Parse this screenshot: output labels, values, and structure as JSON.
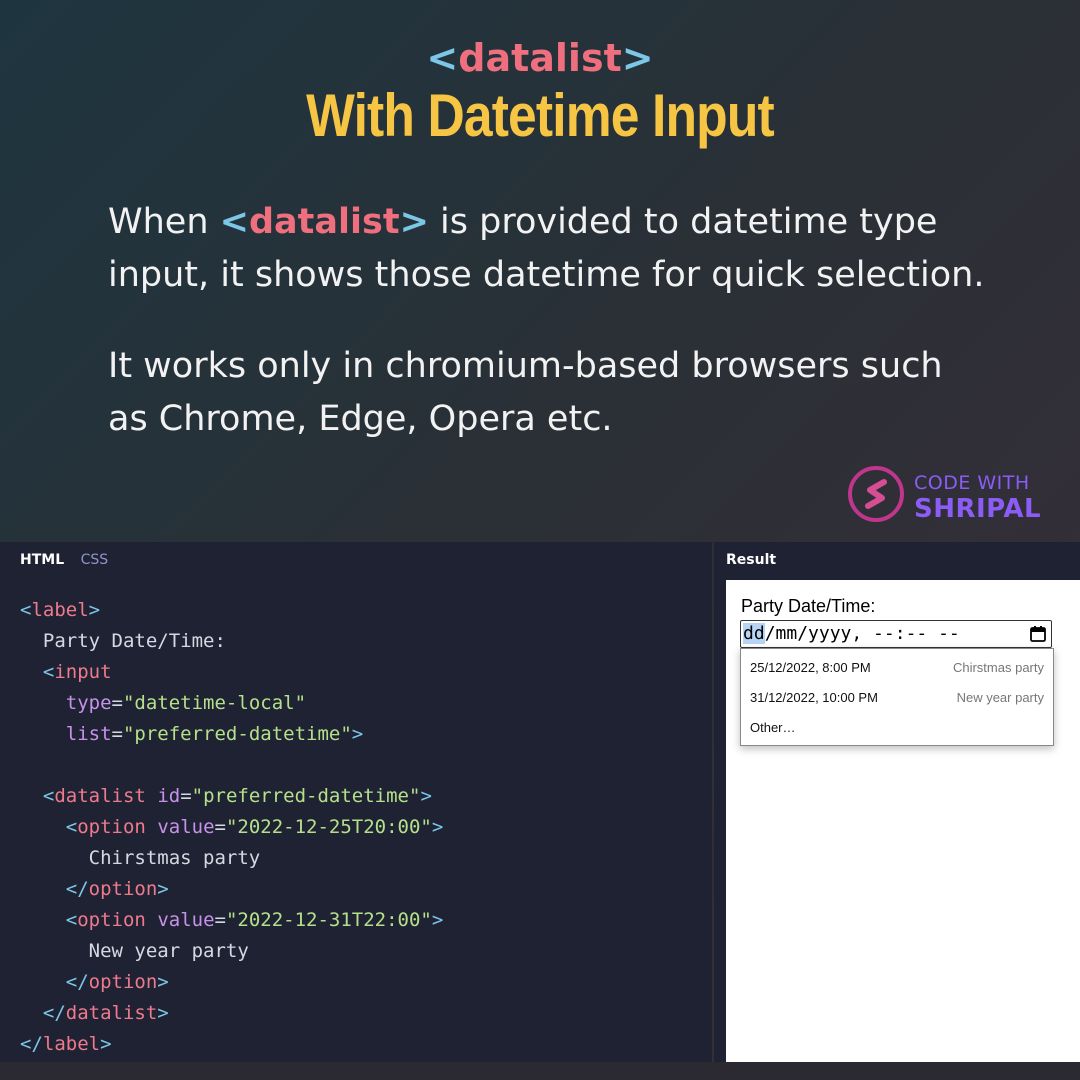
{
  "header": {
    "tag_open": "<",
    "tag_name": "datalist",
    "tag_close": ">",
    "title": "With Datetime Input"
  },
  "description": {
    "p1_before": "When ",
    "p1_tag_open": "<",
    "p1_tag_name": "datalist",
    "p1_tag_close": ">",
    "p1_after": " is provided to datetime type input, it shows those datetime for quick selection.",
    "p2": "It works only in chromium-based browsers such as Chrome, Edge, Opera etc."
  },
  "logo": {
    "line1": "CODE WITH",
    "line2": "SHRIPAL",
    "color": "#8b5cf6"
  },
  "editor": {
    "tabs": [
      {
        "label": "HTML"
      },
      {
        "label": "CSS"
      }
    ],
    "code": {
      "label_open": "label",
      "label_text": "Party Date/Time:",
      "input_tag": "input",
      "type_attr": "type",
      "type_value": "\"datetime-local\"",
      "list_attr": "list",
      "list_value": "\"preferred-datetime\"",
      "datalist_tag": "datalist",
      "id_attr": "id",
      "id_value": "\"preferred-datetime\"",
      "option_tag": "option",
      "value_attr": "value",
      "option1_value": "\"2022-12-25T20:00\"",
      "option1_text": "Chirstmas party",
      "option2_value": "\"2022-12-31T22:00\"",
      "option2_text": "New year party"
    }
  },
  "result": {
    "title": "Result",
    "field_label": "Party Date/Time:",
    "input_highlight": "dd",
    "input_rest": "/mm/yyyy, --:-- --",
    "options": [
      {
        "value": "25/12/2022, 8:00 PM",
        "label": "Chirstmas party"
      },
      {
        "value": "31/12/2022, 10:00 PM",
        "label": "New year party"
      },
      {
        "value": "Other…",
        "label": ""
      }
    ]
  },
  "colors": {
    "title": "#f7c544",
    "tag_bracket": "#7cc7e8",
    "tag_name": "#ef6f7e",
    "editor_bg": "#1f2233"
  }
}
